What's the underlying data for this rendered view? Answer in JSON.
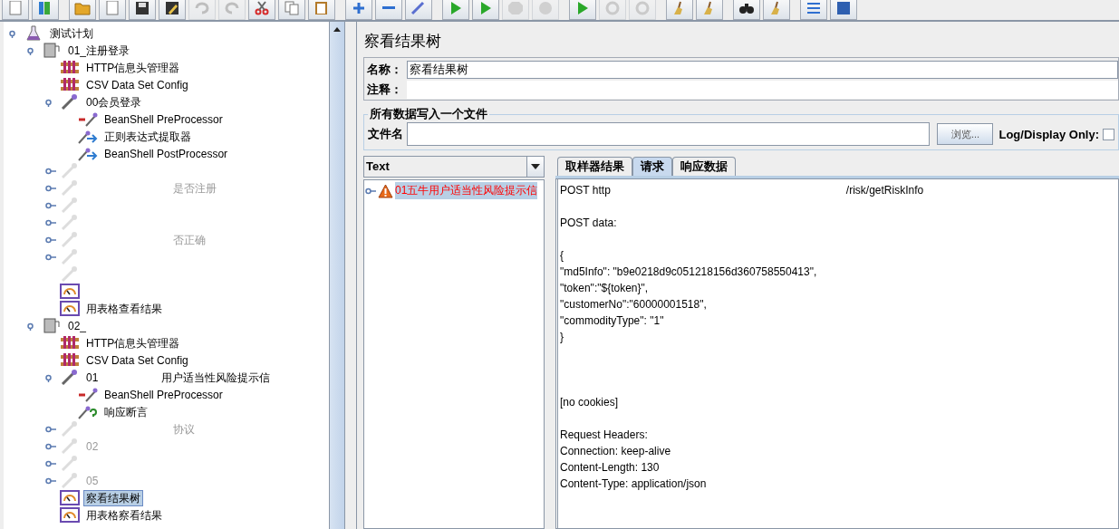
{
  "toolbar": {
    "buttons": [
      {
        "disabled": false
      },
      {
        "disabled": false
      },
      {
        "disabled": false
      },
      {
        "disabled": false
      },
      {
        "disabled": false
      },
      {
        "disabled": false
      },
      {
        "disabled": true
      },
      {
        "disabled": true
      },
      {
        "disabled": false
      },
      {
        "disabled": false
      },
      {
        "disabled": false
      },
      {
        "disabled": false
      },
      {
        "disabled": false
      },
      {
        "disabled": false
      },
      {
        "disabled": false
      },
      {
        "disabled": false
      },
      {
        "disabled": true
      },
      {
        "disabled": true
      },
      {
        "disabled": false
      },
      {
        "disabled": true
      },
      {
        "disabled": true
      },
      {
        "disabled": false
      },
      {
        "disabled": false
      },
      {
        "disabled": false
      },
      {
        "disabled": false
      },
      {
        "disabled": false
      },
      {
        "disabled": false
      }
    ]
  },
  "tree": [
    {
      "kind": "plan",
      "label": "测试计划",
      "selected": false,
      "expanded": true,
      "disabled": false,
      "children": [
        {
          "kind": "thread",
          "label": "01_注册登录",
          "selected": false,
          "expanded": true,
          "disabled": false,
          "children": [
            {
              "kind": "config",
              "label": "HTTP信息头管理器",
              "selected": false,
              "disabled": false
            },
            {
              "kind": "config",
              "label": "CSV Data Set Config",
              "selected": false,
              "disabled": false
            },
            {
              "kind": "sampler",
              "label": "00会员登录",
              "selected": false,
              "expanded": true,
              "disabled": false,
              "children": [
                {
                  "kind": "pre",
                  "label": "BeanShell PreProcessor",
                  "selected": false,
                  "disabled": false
                },
                {
                  "kind": "post",
                  "label": "正则表达式提取器",
                  "selected": false,
                  "disabled": false
                },
                {
                  "kind": "post",
                  "label": "BeanShell PostProcessor",
                  "selected": false,
                  "disabled": false
                }
              ]
            },
            {
              "kind": "sampler",
              "selected": false,
              "expanded": false,
              "disabled": true
            },
            {
              "kind": "sampler",
              "tail": "是否注册",
              "selected": false,
              "expanded": false,
              "disabled": true
            },
            {
              "kind": "sampler",
              "selected": false,
              "expanded": false,
              "disabled": true
            },
            {
              "kind": "sampler",
              "selected": false,
              "expanded": false,
              "disabled": true
            },
            {
              "kind": "sampler",
              "tail": "否正确",
              "selected": false,
              "expanded": false,
              "disabled": true
            },
            {
              "kind": "sampler",
              "selected": false,
              "expanded": false,
              "disabled": true
            },
            {
              "kind": "sampler",
              "selected": false,
              "disabled": true
            },
            {
              "kind": "listener",
              "selected": false,
              "disabled": false
            },
            {
              "kind": "listener",
              "label": "用表格查看结果",
              "selected": false,
              "disabled": false
            }
          ]
        },
        {
          "kind": "thread",
          "label": "02_",
          "selected": false,
          "expanded": true,
          "disabled": false,
          "children": [
            {
              "kind": "config",
              "label": "HTTP信息头管理器",
              "selected": false,
              "disabled": false
            },
            {
              "kind": "config",
              "label": "CSV Data Set Config",
              "selected": false,
              "disabled": false
            },
            {
              "kind": "sampler",
              "label": "01",
              "tail": "用户适当性风险提示信",
              "selected": false,
              "expanded": true,
              "disabled": false,
              "children": [
                {
                  "kind": "pre",
                  "label": "BeanShell PreProcessor",
                  "selected": false,
                  "disabled": false
                },
                {
                  "kind": "assert",
                  "label": "响应断言",
                  "selected": false,
                  "disabled": false
                }
              ]
            },
            {
              "kind": "sampler",
              "tail": "协议",
              "selected": false,
              "expanded": false,
              "disabled": true
            },
            {
              "kind": "sampler",
              "label": "02",
              "selected": false,
              "expanded": false,
              "disabled": true
            },
            {
              "kind": "sampler",
              "selected": false,
              "expanded": false,
              "disabled": true
            },
            {
              "kind": "sampler",
              "label": "05",
              "selected": false,
              "expanded": false,
              "disabled": true
            },
            {
              "kind": "listener",
              "label": "察看结果树",
              "selected": true,
              "disabled": false
            },
            {
              "kind": "listener",
              "label": "用表格察看结果",
              "selected": false,
              "disabled": false
            }
          ]
        }
      ]
    }
  ],
  "panel": {
    "title": "察看结果树",
    "name_label": "名称：",
    "name_value": "察看结果树",
    "comment_label": "注释：",
    "file_group": {
      "legend": "所有数据写入一个文件",
      "file_label": "文件名",
      "browse_button": "浏览...",
      "log_only_label": "Log/Display Only:",
      "log_only_checked": false
    }
  },
  "results": {
    "renderer": "Text",
    "items": [
      {
        "label": "01五牛用户适当性风险提示信",
        "expanded": false,
        "selected": true
      }
    ]
  },
  "detail": {
    "tabs": [
      {
        "label": "取样器结果",
        "selected": false
      },
      {
        "label": "请求",
        "selected": true
      },
      {
        "label": "响应数据",
        "selected": false
      }
    ],
    "url_start": "POST http",
    "url_end": "/risk/getRiskInfo",
    "body": "POST data:\n\n{\n\"md5Info\": \"b9e0218d9c051218156d360758550413\",\n\"token\":\"${token}\",\n\"customerNo\":\"60000001518\",\n\"commodityType\": \"1\"\n}\n\n\n\n[no cookies]\n\nRequest Headers:\nConnection: keep-alive\nContent-Length: 130\nContent-Type: application/json"
  }
}
